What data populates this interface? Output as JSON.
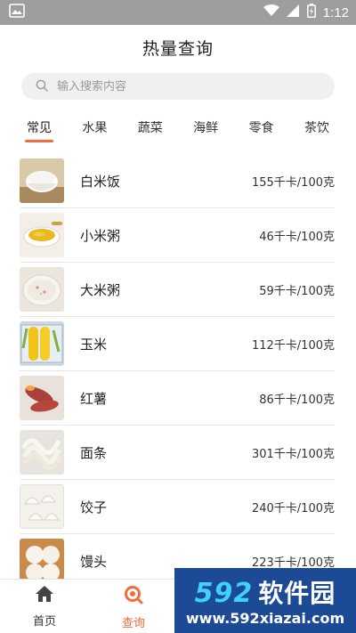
{
  "status_bar": {
    "time": "1:12",
    "icons": [
      "image-icon",
      "wifi-icon",
      "signal-icon",
      "battery-icon"
    ]
  },
  "header": {
    "title": "热量查询"
  },
  "search": {
    "placeholder": "输入搜索内容",
    "value": ""
  },
  "tabs": [
    {
      "label": "常见",
      "active": true
    },
    {
      "label": "水果",
      "active": false
    },
    {
      "label": "蔬菜",
      "active": false
    },
    {
      "label": "海鲜",
      "active": false
    },
    {
      "label": "零食",
      "active": false
    },
    {
      "label": "茶饮",
      "active": false
    }
  ],
  "foods": [
    {
      "name": "白米饭",
      "kcal": "155千卡/100克",
      "icon": "rice-bowl-image"
    },
    {
      "name": "小米粥",
      "kcal": "46千卡/100克",
      "icon": "millet-porridge-image"
    },
    {
      "name": "大米粥",
      "kcal": "59千卡/100克",
      "icon": "rice-porridge-image"
    },
    {
      "name": "玉米",
      "kcal": "112千卡/100克",
      "icon": "corn-image"
    },
    {
      "name": "红薯",
      "kcal": "86千卡/100克",
      "icon": "sweet-potato-image"
    },
    {
      "name": "面条",
      "kcal": "301千卡/100克",
      "icon": "noodles-image"
    },
    {
      "name": "饺子",
      "kcal": "240千卡/100克",
      "icon": "dumplings-image"
    },
    {
      "name": "馒头",
      "kcal": "223千卡/100克",
      "icon": "steamed-bun-image"
    }
  ],
  "bottom_nav": [
    {
      "label": "首页",
      "icon": "home-icon",
      "active": false
    },
    {
      "label": "查询",
      "icon": "search-icon",
      "active": true
    }
  ],
  "watermark": {
    "brand_number": "592",
    "brand_text": "软件园",
    "url": "www.592xiazai.com"
  },
  "colors": {
    "accent": "#f06d3a",
    "status_bar": "#9e9e9e",
    "watermark_bg": "#1c4a94",
    "watermark_number": "#3fd0ff"
  }
}
